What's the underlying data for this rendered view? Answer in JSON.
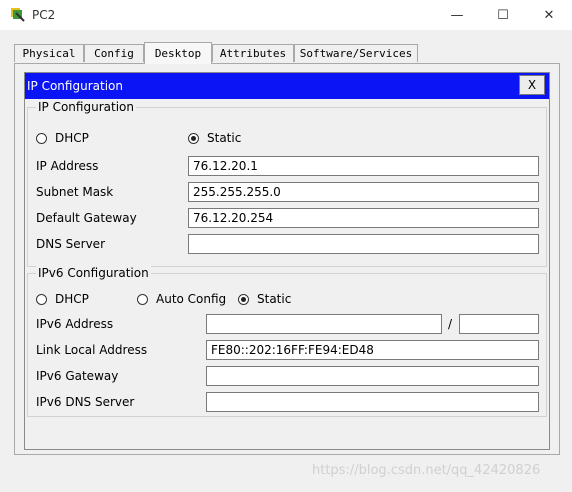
{
  "window": {
    "title": "PC2",
    "min_glyph": "—",
    "max_glyph": "☐",
    "close_glyph": "✕"
  },
  "tabs": [
    {
      "label": "Physical"
    },
    {
      "label": "Config"
    },
    {
      "label": "Desktop",
      "active": true
    },
    {
      "label": "Attributes"
    },
    {
      "label": "Software/Services"
    }
  ],
  "ipconfig": {
    "header_title": "IP Configuration",
    "close_label": "X",
    "ipv4": {
      "group_title": "IP Configuration",
      "mode_options": [
        "DHCP",
        "Static"
      ],
      "selected_mode": "Static",
      "labels": {
        "ip_address": "IP Address",
        "subnet_mask": "Subnet Mask",
        "default_gateway": "Default Gateway",
        "dns_server": "DNS Server"
      },
      "values": {
        "ip_address": "76.12.20.1",
        "subnet_mask": "255.255.255.0",
        "default_gateway": "76.12.20.254",
        "dns_server": ""
      }
    },
    "ipv6": {
      "group_title": "IPv6 Configuration",
      "mode_options": [
        "DHCP",
        "Auto Config",
        "Static"
      ],
      "selected_mode": "Static",
      "labels": {
        "ipv6_address": "IPv6 Address",
        "link_local_address": "Link Local Address",
        "ipv6_gateway": "IPv6 Gateway",
        "ipv6_dns_server": "IPv6 DNS Server"
      },
      "prefix_separator": "/",
      "values": {
        "ipv6_address": "",
        "prefix_length": "",
        "link_local_address": "FE80::202:16FF:FE94:ED48",
        "ipv6_gateway": "",
        "ipv6_dns_server": ""
      }
    }
  },
  "watermark": "https://blog.csdn.net/qq_42420826"
}
